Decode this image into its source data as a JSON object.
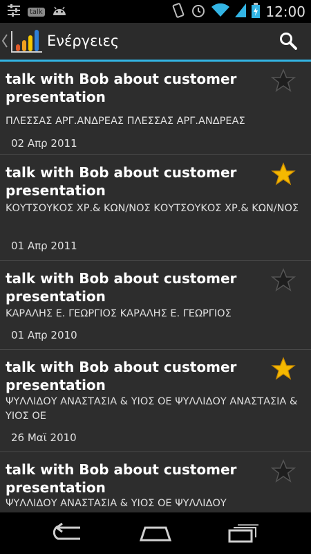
{
  "status_bar": {
    "time": "12:00",
    "notification_icons": [
      "sliders-icon",
      "talk-icon",
      "android-icon"
    ],
    "talk_label": "talk",
    "system_icons": [
      "vibrate-icon",
      "alarm-icon",
      "wifi-icon",
      "battery-icon",
      "signal-icon"
    ]
  },
  "action_bar": {
    "title": "Ενέργειες",
    "accent_color": "#33b5e5"
  },
  "items": [
    {
      "title": "talk with Bob about customer presentation",
      "subtitle": "ΠΛΕΣΣΑΣ ΑΡΓ.ΑΝΔΡΕΑΣ ΠΛΕΣΣΑΣ ΑΡΓ.ΑΝΔΡΕΑΣ",
      "date": "02 Απρ 2011",
      "starred": false
    },
    {
      "title": "talk with Bob about customer presentation",
      "subtitle": "ΚΟΥΤΣΟΥΚΟΣ ΧΡ.& ΚΩΝ/ΝΟΣ ΚΟΥΤΣΟΥΚΟΣ ΧΡ.& ΚΩΝ/ΝΟΣ",
      "date": "01 Απρ 2011",
      "starred": true
    },
    {
      "title": "talk with Bob about customer presentation",
      "subtitle": "ΚΑΡΑΛΗΣ Ε. ΓΕΩΡΓΙΟΣ ΚΑΡΑΛΗΣ Ε. ΓΕΩΡΓΙΟΣ",
      "date": "01 Απρ 2010",
      "starred": false
    },
    {
      "title": "talk with Bob about customer presentation",
      "subtitle": "ΨΥΛΛΙΔΟΥ ΑΝΑΣΤΑΣΙΑ & ΥΙΟΣ ΟΕ ΨΥΛΛΙΔΟΥ ΑΝΑΣΤΑΣΙΑ & ΥΙΟΣ ΟΕ",
      "date": "26 Μαϊ 2010",
      "starred": true
    },
    {
      "title": "talk with Bob about customer presentation",
      "subtitle": "ΨΥΛΛΙΔΟΥ ΑΝΑΣΤΑΣΙΑ & ΥΙΟΣ ΟΕ ΨΥΛΛΙΔΟΥ",
      "date": "",
      "starred": false
    }
  ],
  "colors": {
    "star_on": "#f5b800",
    "star_off": "#1e1e1e",
    "list_bg": "#2d2d2d"
  },
  "navigation": {
    "buttons": [
      "back-icon",
      "home-icon",
      "recent-apps-icon"
    ]
  }
}
